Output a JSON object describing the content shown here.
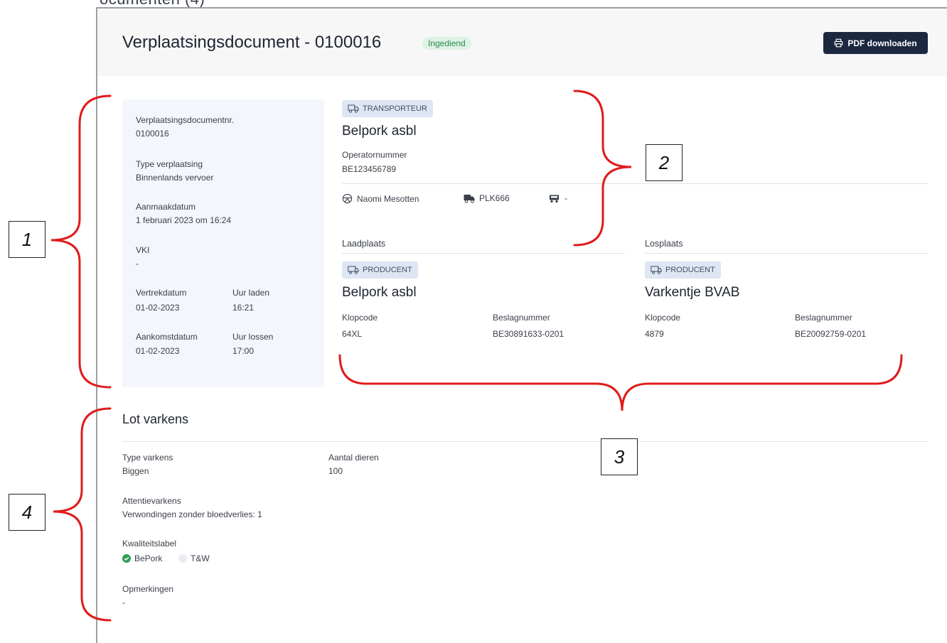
{
  "header": {
    "top_clipped_text": "ocumenten (4)",
    "title": "Verplaatsingsdocument - 0100016",
    "status": "Ingediend",
    "pdf_button": "PDF downloaden"
  },
  "details": {
    "doc_number_label": "Verplaatsingsdocumentnr.",
    "doc_number": "0100016",
    "type_label": "Type verplaatsing",
    "type_value": "Binnenlands vervoer",
    "created_label": "Aanmaakdatum",
    "created_value": "1 februari 2023 om 16:24",
    "vki_label": "VKI",
    "vki_value": "-",
    "departure_label": "Vertrekdatum",
    "departure_value": "01-02-2023",
    "load_time_label": "Uur laden",
    "load_time_value": "16:21",
    "arrival_label": "Aankomstdatum",
    "arrival_value": "01-02-2023",
    "unload_time_label": "Uur lossen",
    "unload_time_value": "17:00"
  },
  "transporter": {
    "tag": "TRANSPORTEUR",
    "name": "Belpork asbl",
    "operator_label": "Operatornummer",
    "operator_value": "BE123456789",
    "driver": "Naomi Mesotten",
    "truck_plate": "PLK666",
    "trailer": "-"
  },
  "loading": {
    "section_title": "Laadplaats",
    "tag": "PRODUCENT",
    "name": "Belpork asbl",
    "klopcode_label": "Klopcode",
    "klopcode_value": "64XL",
    "beslag_label": "Beslagnummer",
    "beslag_value": "BE30891633-0201"
  },
  "unloading": {
    "section_title": "Losplaats",
    "tag": "PRODUCENT",
    "name": "Varkentje BVAB",
    "klopcode_label": "Klopcode",
    "klopcode_value": "4879",
    "beslag_label": "Beslagnummer",
    "beslag_value": "BE20092759-0201"
  },
  "lot": {
    "title": "Lot varkens",
    "type_label": "Type varkens",
    "type_value": "Biggen",
    "count_label": "Aantal dieren",
    "count_value": "100",
    "attention_label": "Attentievarkens",
    "attention_value": "Verwondingen zonder bloedverlies: 1",
    "quality_label": "Kwaliteitslabel",
    "quality_options": [
      {
        "label": "BePork",
        "checked": true
      },
      {
        "label": "T&W",
        "checked": false
      }
    ],
    "remarks_label": "Opmerkingen",
    "remarks_value": "-"
  },
  "annotations": [
    "1",
    "2",
    "3",
    "4"
  ],
  "colors": {
    "annotation_red": "#e01b1b",
    "button_bg": "#1c2740",
    "badge_green": "#2c8a4d",
    "panel_bg": "#f3f6fa"
  }
}
